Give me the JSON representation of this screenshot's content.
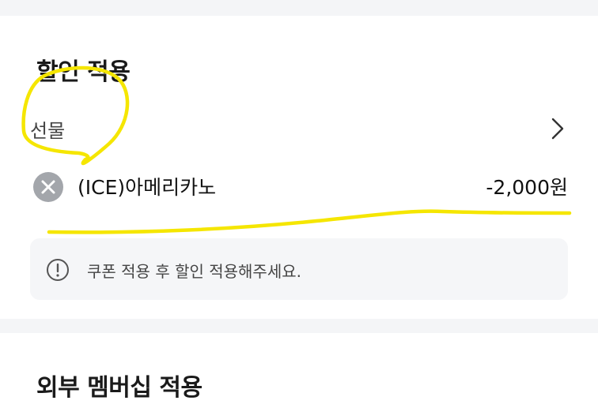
{
  "discount": {
    "title": "할인 적용",
    "gift_label": "선물",
    "item": {
      "name": "(ICE)아메리카노",
      "price": "-2,000원"
    },
    "notice": "쿠폰 적용 후 할인 적용해주세요."
  },
  "membership": {
    "title": "외부 멤버십 적용"
  },
  "icons": {
    "remove": "close-circle-icon",
    "chevron": "chevron-right-icon",
    "notice": "exclamation-circle-icon"
  },
  "colors": {
    "annotation": "#f5e600",
    "remove_button": "#a3a6ab",
    "notice_background": "#f5f6f8"
  }
}
